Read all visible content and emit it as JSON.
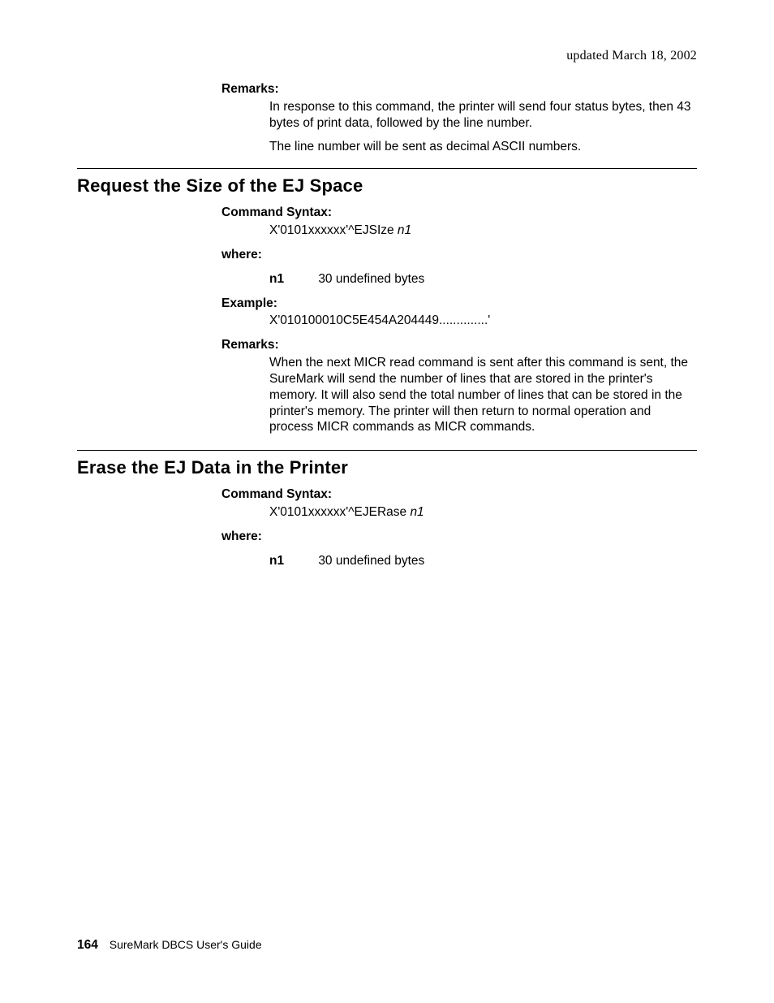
{
  "header": {
    "updated": "updated March 18, 2002"
  },
  "sec0": {
    "remarks_label": "Remarks:",
    "remarks_p1": "In response to this command, the printer will send four status bytes, then 43 bytes of print data, followed by the line number.",
    "remarks_p2": "The line number will be sent as decimal ASCII numbers."
  },
  "sec1": {
    "title": "Request the Size of the EJ Space",
    "syntax_label": "Command Syntax:",
    "syntax_prefix": "X'0101xxxxxx'^EJSIze ",
    "syntax_arg": "n1",
    "where_label": "where:",
    "param_key": "n1",
    "param_val": "30 undefined bytes",
    "example_label": "Example:",
    "example_val": "X'010100010C5E454A204449..............'",
    "remarks_label": "Remarks:",
    "remarks_body": "When the next MICR read command is sent after this command is sent, the SureMark will send the number of lines that are stored in the printer's memory. It will also send the total number of lines that can be stored in the printer's memory. The printer will then return to normal operation and process MICR commands as MICR commands."
  },
  "sec2": {
    "title": "Erase the EJ Data in the Printer",
    "syntax_label": "Command Syntax:",
    "syntax_prefix": "X'0101xxxxxx'^EJERase ",
    "syntax_arg": "n1",
    "where_label": "where:",
    "param_key": "n1",
    "param_val": "30 undefined bytes"
  },
  "footer": {
    "page_number": "164",
    "doc_title": "SureMark DBCS User's Guide"
  }
}
